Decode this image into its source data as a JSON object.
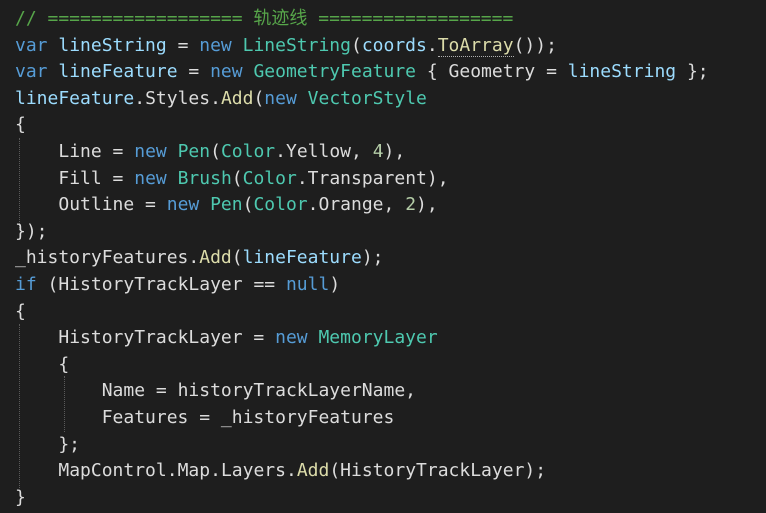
{
  "editor": {
    "colors": {
      "background": "#1e1e1e",
      "comment": "#57a64a",
      "keyword": "#569cd6",
      "type": "#4ec9b0",
      "method": "#dcdcaa",
      "number": "#b5cea8",
      "property": "#dcdcdc",
      "local": "#9cdcfe",
      "plain": "#dcdcdc"
    },
    "lines": [
      [
        {
          "t": "// ================== 轨迹线 ==================",
          "c": "comment"
        }
      ],
      [
        {
          "t": "var",
          "c": "keyword"
        },
        {
          "t": " ",
          "c": "plain"
        },
        {
          "t": "lineString",
          "c": "local"
        },
        {
          "t": " = ",
          "c": "plain"
        },
        {
          "t": "new",
          "c": "keyword"
        },
        {
          "t": " ",
          "c": "plain"
        },
        {
          "t": "LineString",
          "c": "type"
        },
        {
          "t": "(",
          "c": "plain"
        },
        {
          "t": "coords",
          "c": "local"
        },
        {
          "t": ".",
          "c": "plain"
        },
        {
          "t": "ToArray",
          "c": "method",
          "hint": true
        },
        {
          "t": "());",
          "c": "plain"
        }
      ],
      [
        {
          "t": "var",
          "c": "keyword"
        },
        {
          "t": " ",
          "c": "plain"
        },
        {
          "t": "lineFeature",
          "c": "local"
        },
        {
          "t": " = ",
          "c": "plain"
        },
        {
          "t": "new",
          "c": "keyword"
        },
        {
          "t": " ",
          "c": "plain"
        },
        {
          "t": "GeometryFeature",
          "c": "type"
        },
        {
          "t": " { ",
          "c": "plain"
        },
        {
          "t": "Geometry",
          "c": "prop"
        },
        {
          "t": " = ",
          "c": "plain"
        },
        {
          "t": "lineString",
          "c": "local"
        },
        {
          "t": " };",
          "c": "plain"
        }
      ],
      [
        {
          "t": "lineFeature",
          "c": "local"
        },
        {
          "t": ".",
          "c": "plain"
        },
        {
          "t": "Styles",
          "c": "prop"
        },
        {
          "t": ".",
          "c": "plain"
        },
        {
          "t": "Add",
          "c": "method"
        },
        {
          "t": "(",
          "c": "plain"
        },
        {
          "t": "new",
          "c": "keyword"
        },
        {
          "t": " ",
          "c": "plain"
        },
        {
          "t": "VectorStyle",
          "c": "type"
        }
      ],
      [
        {
          "t": "{",
          "c": "plain"
        }
      ],
      [
        {
          "t": "    ",
          "c": "plain"
        },
        {
          "t": "Line",
          "c": "prop"
        },
        {
          "t": " = ",
          "c": "plain"
        },
        {
          "t": "new",
          "c": "keyword"
        },
        {
          "t": " ",
          "c": "plain"
        },
        {
          "t": "Pen",
          "c": "type"
        },
        {
          "t": "(",
          "c": "plain"
        },
        {
          "t": "Color",
          "c": "type"
        },
        {
          "t": ".",
          "c": "plain"
        },
        {
          "t": "Yellow",
          "c": "prop"
        },
        {
          "t": ", ",
          "c": "plain"
        },
        {
          "t": "4",
          "c": "number"
        },
        {
          "t": "),",
          "c": "plain"
        }
      ],
      [
        {
          "t": "    ",
          "c": "plain"
        },
        {
          "t": "Fill",
          "c": "prop"
        },
        {
          "t": " = ",
          "c": "plain"
        },
        {
          "t": "new",
          "c": "keyword"
        },
        {
          "t": " ",
          "c": "plain"
        },
        {
          "t": "Brush",
          "c": "type"
        },
        {
          "t": "(",
          "c": "plain"
        },
        {
          "t": "Color",
          "c": "type"
        },
        {
          "t": ".",
          "c": "plain"
        },
        {
          "t": "Transparent",
          "c": "prop"
        },
        {
          "t": "),",
          "c": "plain"
        }
      ],
      [
        {
          "t": "    ",
          "c": "plain"
        },
        {
          "t": "Outline",
          "c": "prop"
        },
        {
          "t": " = ",
          "c": "plain"
        },
        {
          "t": "new",
          "c": "keyword"
        },
        {
          "t": " ",
          "c": "plain"
        },
        {
          "t": "Pen",
          "c": "type"
        },
        {
          "t": "(",
          "c": "plain"
        },
        {
          "t": "Color",
          "c": "type"
        },
        {
          "t": ".",
          "c": "plain"
        },
        {
          "t": "Orange",
          "c": "prop"
        },
        {
          "t": ", ",
          "c": "plain"
        },
        {
          "t": "2",
          "c": "number"
        },
        {
          "t": "),",
          "c": "plain"
        }
      ],
      [
        {
          "t": "});",
          "c": "plain"
        }
      ],
      [
        {
          "t": "_historyFeatures",
          "c": "prop"
        },
        {
          "t": ".",
          "c": "plain"
        },
        {
          "t": "Add",
          "c": "method"
        },
        {
          "t": "(",
          "c": "plain"
        },
        {
          "t": "lineFeature",
          "c": "local"
        },
        {
          "t": ");",
          "c": "plain"
        }
      ],
      [
        {
          "t": "if",
          "c": "keyword"
        },
        {
          "t": " (",
          "c": "plain"
        },
        {
          "t": "HistoryTrackLayer",
          "c": "prop"
        },
        {
          "t": " == ",
          "c": "plain"
        },
        {
          "t": "null",
          "c": "keyword"
        },
        {
          "t": ")",
          "c": "plain"
        }
      ],
      [
        {
          "t": "{",
          "c": "plain"
        }
      ],
      [
        {
          "t": "    ",
          "c": "plain"
        },
        {
          "t": "HistoryTrackLayer",
          "c": "prop"
        },
        {
          "t": " = ",
          "c": "plain"
        },
        {
          "t": "new",
          "c": "keyword"
        },
        {
          "t": " ",
          "c": "plain"
        },
        {
          "t": "MemoryLayer",
          "c": "type"
        }
      ],
      [
        {
          "t": "    {",
          "c": "plain"
        }
      ],
      [
        {
          "t": "        ",
          "c": "plain"
        },
        {
          "t": "Name",
          "c": "prop"
        },
        {
          "t": " = ",
          "c": "plain"
        },
        {
          "t": "historyTrackLayerName",
          "c": "prop"
        },
        {
          "t": ",",
          "c": "plain"
        }
      ],
      [
        {
          "t": "        ",
          "c": "plain"
        },
        {
          "t": "Features",
          "c": "prop"
        },
        {
          "t": " = ",
          "c": "plain"
        },
        {
          "t": "_historyFeatures",
          "c": "prop"
        }
      ],
      [
        {
          "t": "    };",
          "c": "plain"
        }
      ],
      [
        {
          "t": "    ",
          "c": "plain"
        },
        {
          "t": "MapControl",
          "c": "prop"
        },
        {
          "t": ".",
          "c": "plain"
        },
        {
          "t": "Map",
          "c": "prop"
        },
        {
          "t": ".",
          "c": "plain"
        },
        {
          "t": "Layers",
          "c": "prop"
        },
        {
          "t": ".",
          "c": "plain"
        },
        {
          "t": "Add",
          "c": "method"
        },
        {
          "t": "(",
          "c": "plain"
        },
        {
          "t": "HistoryTrackLayer",
          "c": "prop"
        },
        {
          "t": ");",
          "c": "plain"
        }
      ],
      [
        {
          "t": "}",
          "c": "plain"
        }
      ]
    ]
  }
}
